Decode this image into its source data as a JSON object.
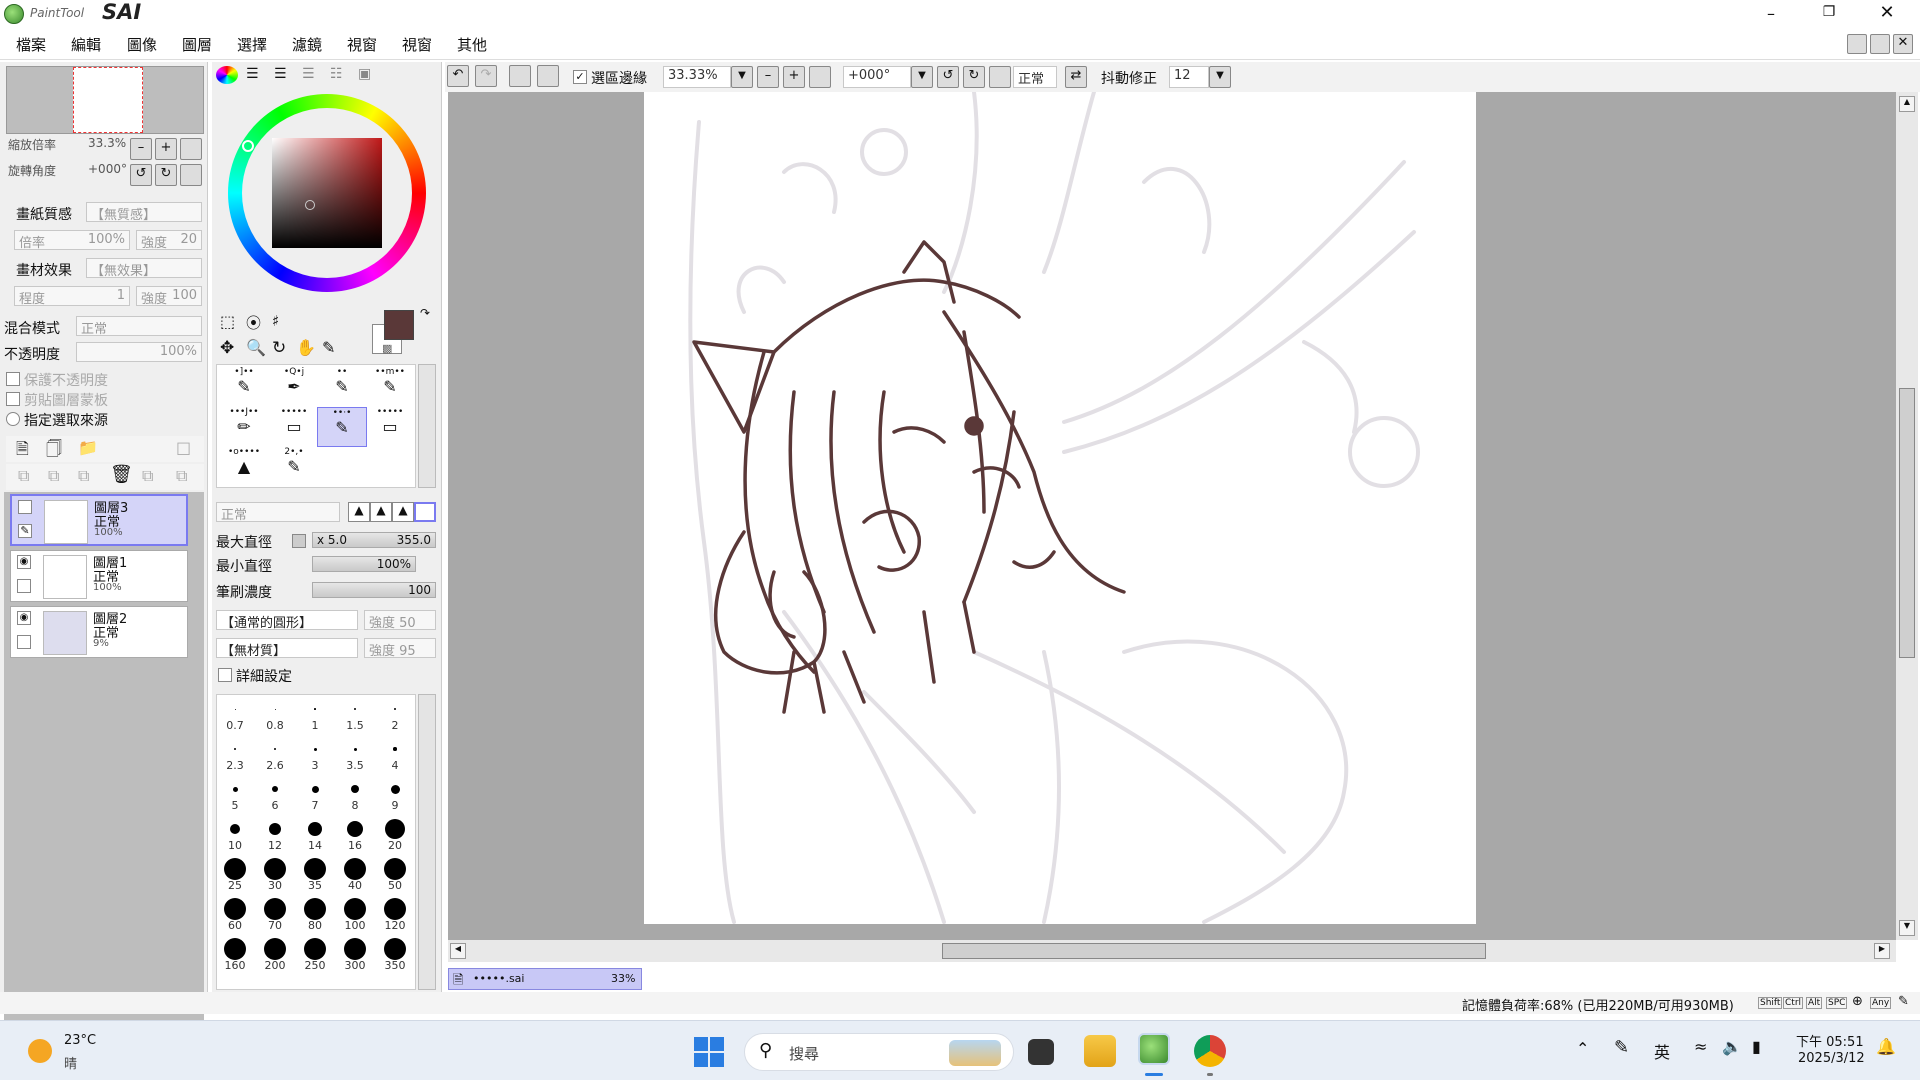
{
  "app": {
    "name_small": "PaintTool",
    "name_big": "SAI"
  },
  "menu": [
    "檔案",
    "編輯",
    "圖像",
    "圖層",
    "選擇",
    "濾鏡",
    "視窗",
    "視窗",
    "其他"
  ],
  "navigator": {
    "zoom_label": "縮放倍率",
    "zoom_value": "33.3%",
    "rotate_label": "旋轉角度",
    "rotate_value": "+000°"
  },
  "paper": {
    "texture_label": "畫紙質感",
    "texture_value": "【無質感】",
    "scale_label": "倍率",
    "scale_value": "100%",
    "strength_label": "強度",
    "strength_value": "20",
    "effect_label": "畫材效果",
    "effect_value": "【無效果】",
    "degree_label": "程度",
    "degree_value": "1",
    "strength2_label": "強度",
    "strength2_value": "100"
  },
  "layer_props": {
    "blend_label": "混合模式",
    "blend_value": "正常",
    "opacity_label": "不透明度",
    "opacity_value": "100%",
    "preserve_opacity": "保護不透明度",
    "clip_group": "剪貼圖層蒙板",
    "selection_source": "指定選取來源"
  },
  "layers": [
    {
      "name": "圖層3",
      "mode": "正常",
      "opacity": "100%",
      "selected": true
    },
    {
      "name": "圖層1",
      "mode": "正常",
      "opacity": "100%",
      "selected": false
    },
    {
      "name": "圖層2",
      "mode": "正常",
      "opacity": "9%",
      "selected": false
    }
  ],
  "colors": {
    "primary": "#5a3838",
    "secondary": "#ffffff",
    "selection": "#d4d4f8",
    "accent": "#7a7af0"
  },
  "brushes": [
    {
      "label": "•]••"
    },
    {
      "label": "•Q•j"
    },
    {
      "label": "••"
    },
    {
      "label": "••m••"
    },
    {
      "label": "•••J••"
    },
    {
      "label": "•••••"
    },
    {
      "label": "••·•"
    },
    {
      "label": "•••••"
    },
    {
      "label": "•o••••"
    },
    {
      "label": "2•,•"
    }
  ],
  "brush_settings": {
    "mode_value": "正常",
    "max_size_label": "最大直徑",
    "max_size_mult": "x 5.0",
    "max_size_value": "355.0",
    "min_size_label": "最小直徑",
    "min_size_value": "100%",
    "density_label": "筆刷濃度",
    "density_value": "100",
    "shape_value": "【通常的圓形】",
    "shape_strength": "強度  50",
    "texture_value": "【無材質】",
    "texture_strength": "強度  95",
    "detail_label": "詳細設定"
  },
  "sizes": [
    "0.7",
    "0.8",
    "1",
    "1.5",
    "2",
    "2.3",
    "2.6",
    "3",
    "3.5",
    "4",
    "5",
    "6",
    "7",
    "8",
    "9",
    "10",
    "12",
    "14",
    "16",
    "20",
    "25",
    "30",
    "35",
    "40",
    "50",
    "60",
    "70",
    "80",
    "100",
    "120",
    "160",
    "200",
    "250",
    "300",
    "350"
  ],
  "toolbar": {
    "selection_edge_label": "選區邊緣",
    "zoom_value": "33.33%",
    "rotate_value": "+000°",
    "mode_value": "正常",
    "stabilizer_label": "抖動修正",
    "stabilizer_value": "12"
  },
  "document_tab": {
    "name": "•••••.sai",
    "zoom": "33%"
  },
  "status": {
    "memory": "記憶體負荷率:68% (已用220MB/可用930MB)",
    "keys": [
      "Shift",
      "Ctrl",
      "Alt",
      "SPC",
      "Any"
    ]
  },
  "taskbar": {
    "weather_temp": "23°C",
    "weather_desc": "晴",
    "search_placeholder": "搜尋",
    "ime": "英",
    "time": "下午 05:51",
    "date": "2025/3/12"
  }
}
